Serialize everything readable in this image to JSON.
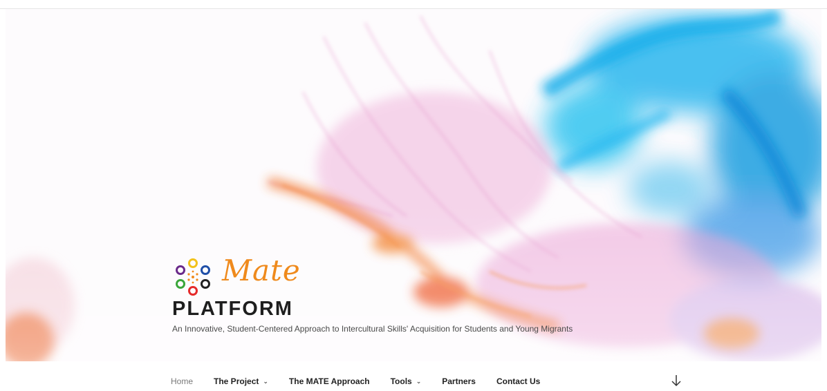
{
  "brand": {
    "logo_word": "Mate",
    "site_title": "PLATFORM",
    "description": "An Innovative, Student-Centered Approach to Intercultural Skills' Acquisition for Students and Young Migrants",
    "accent_color": "#ef8a1c"
  },
  "nav": {
    "items": [
      {
        "label": "Home",
        "current": true,
        "has_dropdown": false
      },
      {
        "label": "The Project",
        "has_dropdown": true
      },
      {
        "label": "The MATE Approach",
        "has_dropdown": false
      },
      {
        "label": "Tools",
        "has_dropdown": true
      },
      {
        "label": "Partners",
        "has_dropdown": false
      },
      {
        "label": "Contact Us",
        "has_dropdown": false
      }
    ],
    "scroll_icon": "arrow-down-icon"
  },
  "colors": {
    "ink_blue": "#1fb4ef",
    "ink_orange": "#f2762a",
    "ink_pink": "#e79ad0"
  }
}
